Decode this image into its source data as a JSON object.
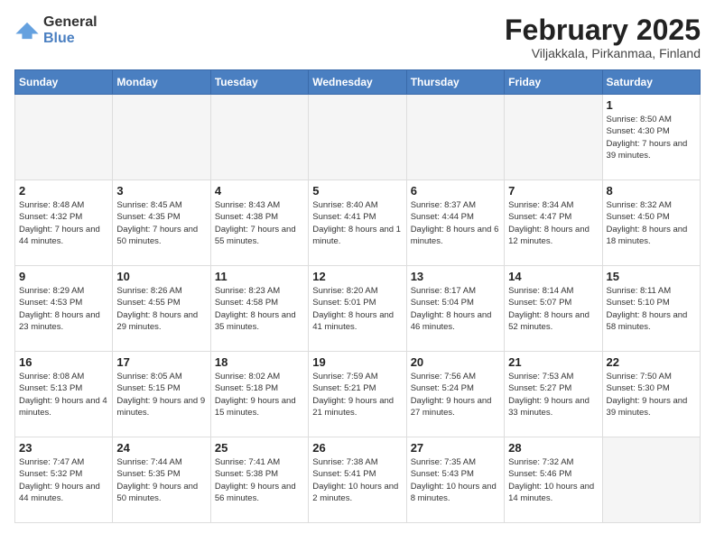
{
  "header": {
    "logo_general": "General",
    "logo_blue": "Blue",
    "title": "February 2025",
    "subtitle": "Viljakkala, Pirkanmaa, Finland"
  },
  "weekdays": [
    "Sunday",
    "Monday",
    "Tuesday",
    "Wednesday",
    "Thursday",
    "Friday",
    "Saturday"
  ],
  "weeks": [
    [
      {
        "day": "",
        "info": ""
      },
      {
        "day": "",
        "info": ""
      },
      {
        "day": "",
        "info": ""
      },
      {
        "day": "",
        "info": ""
      },
      {
        "day": "",
        "info": ""
      },
      {
        "day": "",
        "info": ""
      },
      {
        "day": "1",
        "info": "Sunrise: 8:50 AM\nSunset: 4:30 PM\nDaylight: 7 hours\nand 39 minutes."
      }
    ],
    [
      {
        "day": "2",
        "info": "Sunrise: 8:48 AM\nSunset: 4:32 PM\nDaylight: 7 hours\nand 44 minutes."
      },
      {
        "day": "3",
        "info": "Sunrise: 8:45 AM\nSunset: 4:35 PM\nDaylight: 7 hours\nand 50 minutes."
      },
      {
        "day": "4",
        "info": "Sunrise: 8:43 AM\nSunset: 4:38 PM\nDaylight: 7 hours\nand 55 minutes."
      },
      {
        "day": "5",
        "info": "Sunrise: 8:40 AM\nSunset: 4:41 PM\nDaylight: 8 hours\nand 1 minute."
      },
      {
        "day": "6",
        "info": "Sunrise: 8:37 AM\nSunset: 4:44 PM\nDaylight: 8 hours\nand 6 minutes."
      },
      {
        "day": "7",
        "info": "Sunrise: 8:34 AM\nSunset: 4:47 PM\nDaylight: 8 hours\nand 12 minutes."
      },
      {
        "day": "8",
        "info": "Sunrise: 8:32 AM\nSunset: 4:50 PM\nDaylight: 8 hours\nand 18 minutes."
      }
    ],
    [
      {
        "day": "9",
        "info": "Sunrise: 8:29 AM\nSunset: 4:53 PM\nDaylight: 8 hours\nand 23 minutes."
      },
      {
        "day": "10",
        "info": "Sunrise: 8:26 AM\nSunset: 4:55 PM\nDaylight: 8 hours\nand 29 minutes."
      },
      {
        "day": "11",
        "info": "Sunrise: 8:23 AM\nSunset: 4:58 PM\nDaylight: 8 hours\nand 35 minutes."
      },
      {
        "day": "12",
        "info": "Sunrise: 8:20 AM\nSunset: 5:01 PM\nDaylight: 8 hours\nand 41 minutes."
      },
      {
        "day": "13",
        "info": "Sunrise: 8:17 AM\nSunset: 5:04 PM\nDaylight: 8 hours\nand 46 minutes."
      },
      {
        "day": "14",
        "info": "Sunrise: 8:14 AM\nSunset: 5:07 PM\nDaylight: 8 hours\nand 52 minutes."
      },
      {
        "day": "15",
        "info": "Sunrise: 8:11 AM\nSunset: 5:10 PM\nDaylight: 8 hours\nand 58 minutes."
      }
    ],
    [
      {
        "day": "16",
        "info": "Sunrise: 8:08 AM\nSunset: 5:13 PM\nDaylight: 9 hours\nand 4 minutes."
      },
      {
        "day": "17",
        "info": "Sunrise: 8:05 AM\nSunset: 5:15 PM\nDaylight: 9 hours\nand 9 minutes."
      },
      {
        "day": "18",
        "info": "Sunrise: 8:02 AM\nSunset: 5:18 PM\nDaylight: 9 hours\nand 15 minutes."
      },
      {
        "day": "19",
        "info": "Sunrise: 7:59 AM\nSunset: 5:21 PM\nDaylight: 9 hours\nand 21 minutes."
      },
      {
        "day": "20",
        "info": "Sunrise: 7:56 AM\nSunset: 5:24 PM\nDaylight: 9 hours\nand 27 minutes."
      },
      {
        "day": "21",
        "info": "Sunrise: 7:53 AM\nSunset: 5:27 PM\nDaylight: 9 hours\nand 33 minutes."
      },
      {
        "day": "22",
        "info": "Sunrise: 7:50 AM\nSunset: 5:30 PM\nDaylight: 9 hours\nand 39 minutes."
      }
    ],
    [
      {
        "day": "23",
        "info": "Sunrise: 7:47 AM\nSunset: 5:32 PM\nDaylight: 9 hours\nand 44 minutes."
      },
      {
        "day": "24",
        "info": "Sunrise: 7:44 AM\nSunset: 5:35 PM\nDaylight: 9 hours\nand 50 minutes."
      },
      {
        "day": "25",
        "info": "Sunrise: 7:41 AM\nSunset: 5:38 PM\nDaylight: 9 hours\nand 56 minutes."
      },
      {
        "day": "26",
        "info": "Sunrise: 7:38 AM\nSunset: 5:41 PM\nDaylight: 10 hours\nand 2 minutes."
      },
      {
        "day": "27",
        "info": "Sunrise: 7:35 AM\nSunset: 5:43 PM\nDaylight: 10 hours\nand 8 minutes."
      },
      {
        "day": "28",
        "info": "Sunrise: 7:32 AM\nSunset: 5:46 PM\nDaylight: 10 hours\nand 14 minutes."
      },
      {
        "day": "",
        "info": ""
      }
    ]
  ]
}
